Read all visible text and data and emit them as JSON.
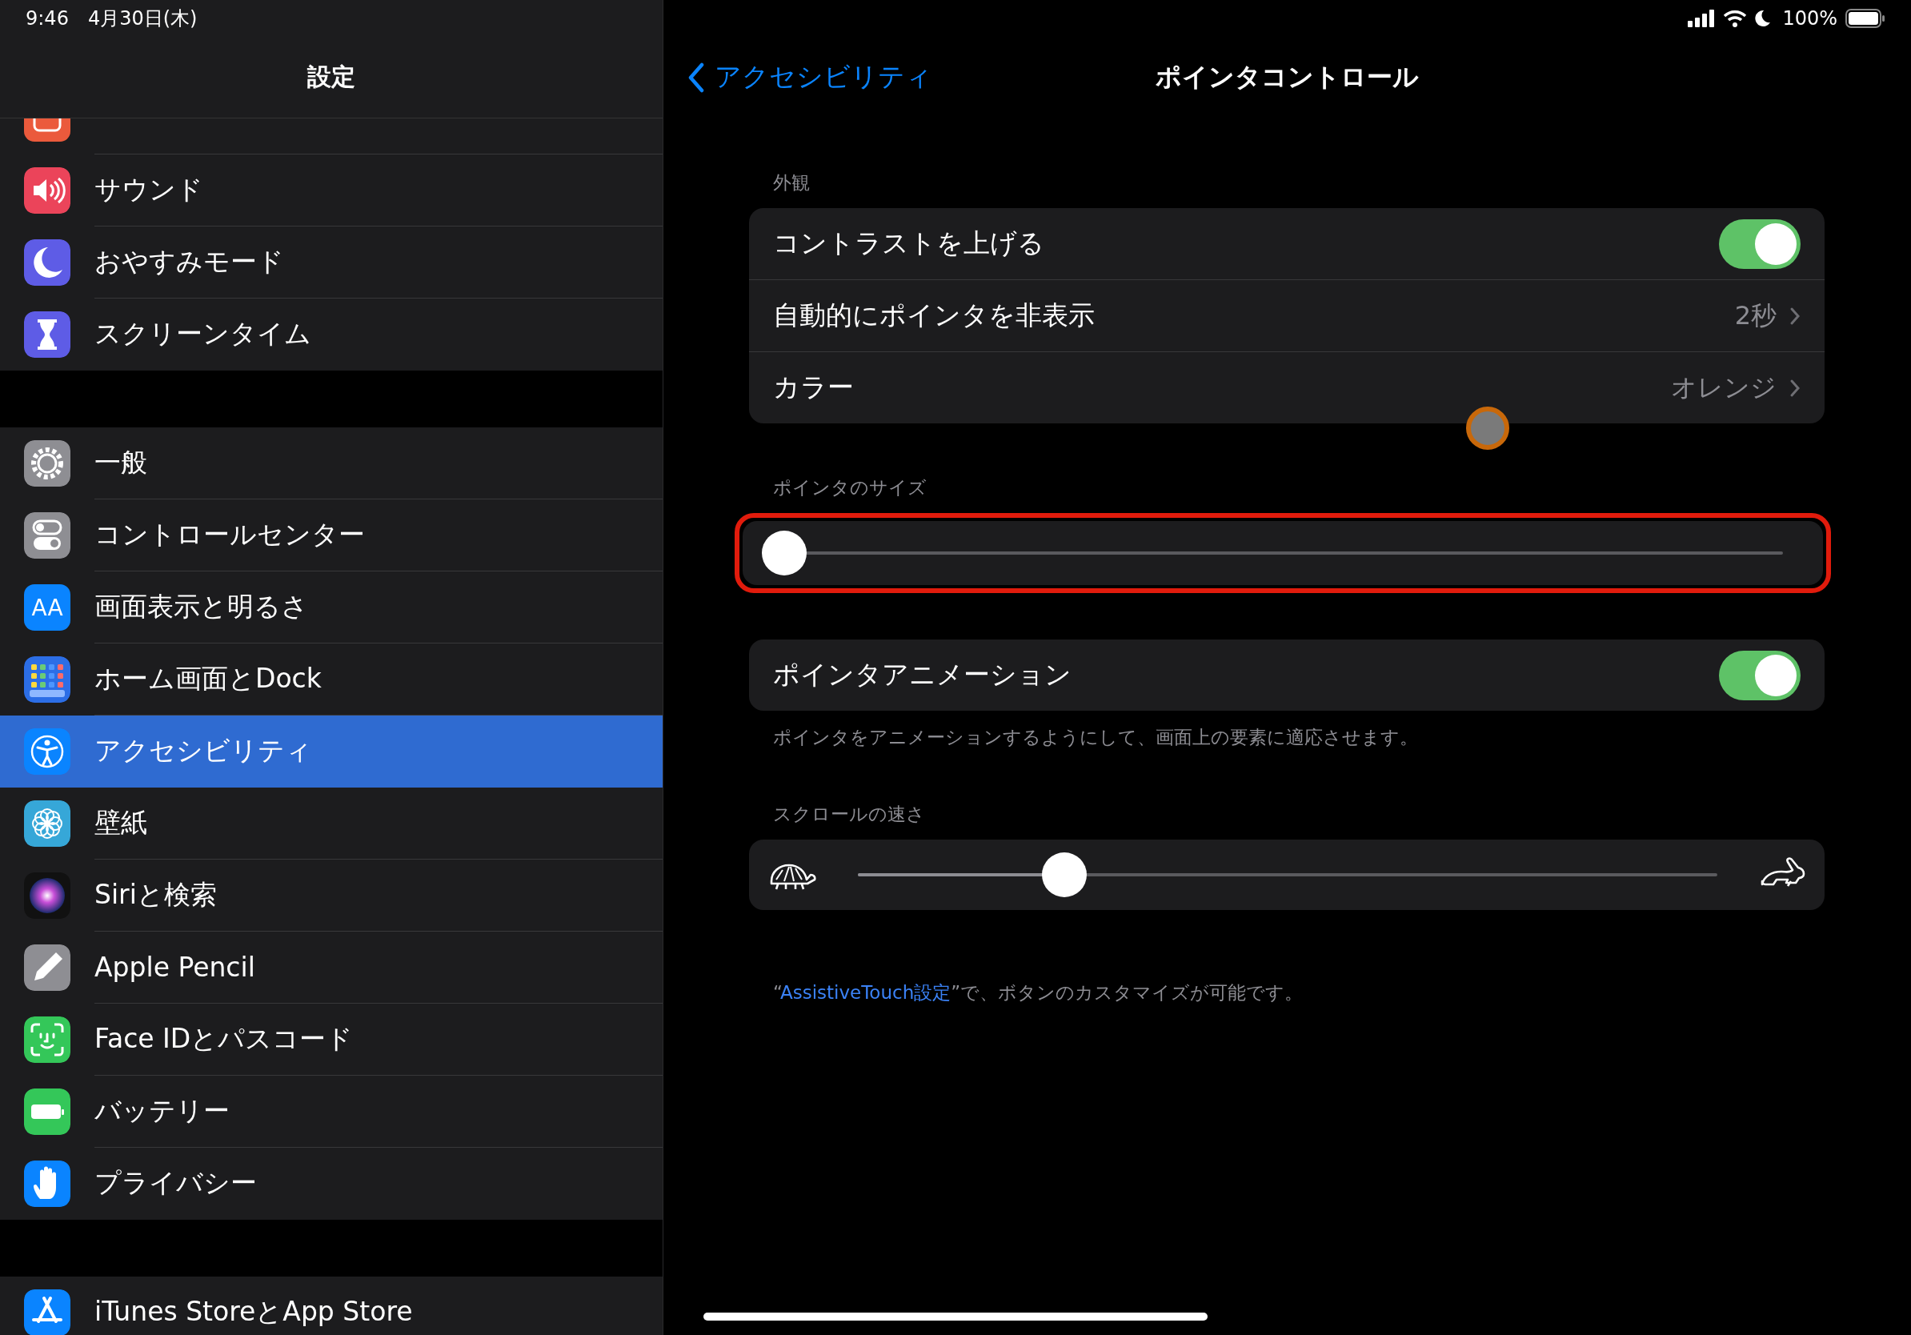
{
  "status_bar": {
    "time": "9:46",
    "date": "4月30日(木)",
    "battery": "100%"
  },
  "sidebar": {
    "title": "設定",
    "groups": [
      {
        "items": [
          {
            "label": "サウンド",
            "selected": false
          },
          {
            "label": "おやすみモード",
            "selected": false
          },
          {
            "label": "スクリーンタイム",
            "selected": false
          }
        ]
      },
      {
        "items": [
          {
            "label": "一般",
            "selected": false
          },
          {
            "label": "コントロールセンター",
            "selected": false
          },
          {
            "label": "画面表示と明るさ",
            "selected": false,
            "icon_text": "AA"
          },
          {
            "label": "ホーム画面とDock",
            "selected": false
          },
          {
            "label": "アクセシビリティ",
            "selected": true
          },
          {
            "label": "壁紙",
            "selected": false
          },
          {
            "label": "Siriと検索",
            "selected": false
          },
          {
            "label": "Apple Pencil",
            "selected": false
          },
          {
            "label": "Face IDとパスコード",
            "selected": false
          },
          {
            "label": "バッテリー",
            "selected": false
          },
          {
            "label": "プライバシー",
            "selected": false
          }
        ]
      },
      {
        "items": [
          {
            "label": "iTunes StoreとApp Store",
            "selected": false
          }
        ]
      }
    ]
  },
  "detail": {
    "back": "アクセシビリティ",
    "title": "ポインタコントロール",
    "sections": [
      {
        "header": "外観",
        "highlighted": false,
        "rows": [
          {
            "kind": "toggle",
            "label": "コントラストを上げる",
            "on": true
          },
          {
            "kind": "link",
            "label": "自動的にポインタを非表示",
            "value": "2秒"
          },
          {
            "kind": "link",
            "label": "カラー",
            "value": "オレンジ"
          }
        ]
      },
      {
        "header": "ポインタのサイズ",
        "highlighted": true,
        "rows": [
          {
            "kind": "slider",
            "level": 0
          }
        ]
      },
      {
        "highlighted": false,
        "rows": [
          {
            "kind": "toggle",
            "label": "ポインタアニメーション",
            "on": true
          }
        ],
        "footer": "ポインタをアニメーションするようにして、画面上の要素に適応させます。"
      },
      {
        "header": "スクロールの速さ",
        "highlighted": false,
        "rows": [
          {
            "kind": "speed_slider",
            "level": 0.24
          }
        ]
      }
    ],
    "note": {
      "prefix": "“",
      "link": "AssistiveTouch設定",
      "suffix": "”で、ボタンのカスタマイズが可能です。"
    }
  }
}
